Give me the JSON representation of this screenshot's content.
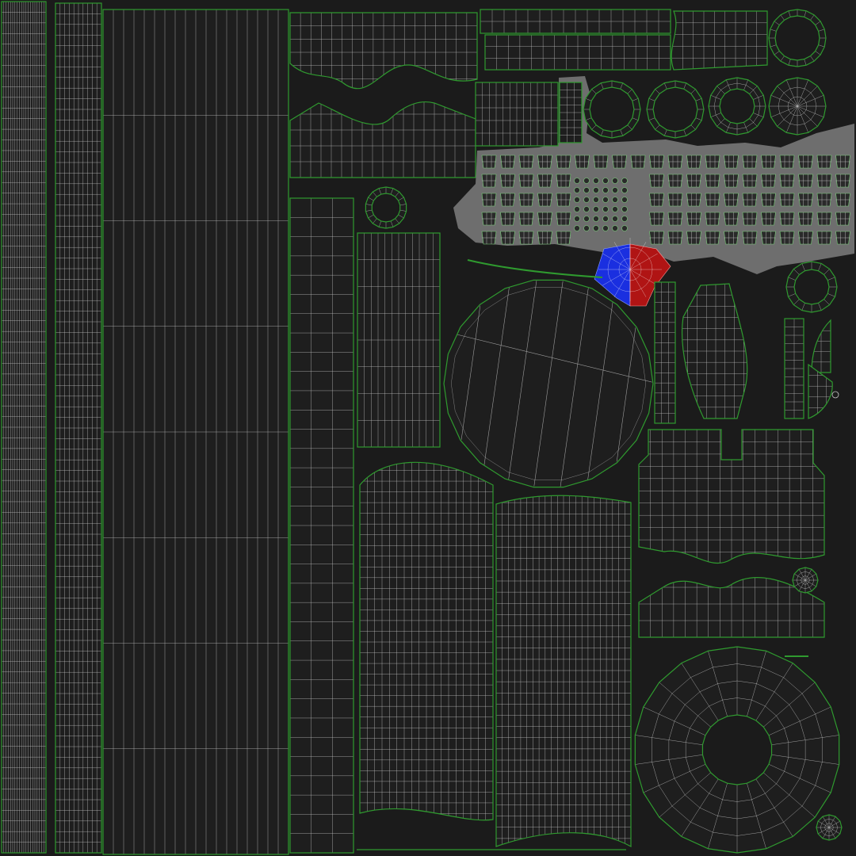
{
  "uv_layout": {
    "colors": {
      "background": "#1b1b1b",
      "island_fill": "#1e1e1e",
      "wire": "#c8c8c8",
      "border": "#2f9a2f",
      "overlap_area": "#6e6e6e",
      "flip_blue": "#1a2fe0",
      "flip_red": "#b01414"
    }
  }
}
